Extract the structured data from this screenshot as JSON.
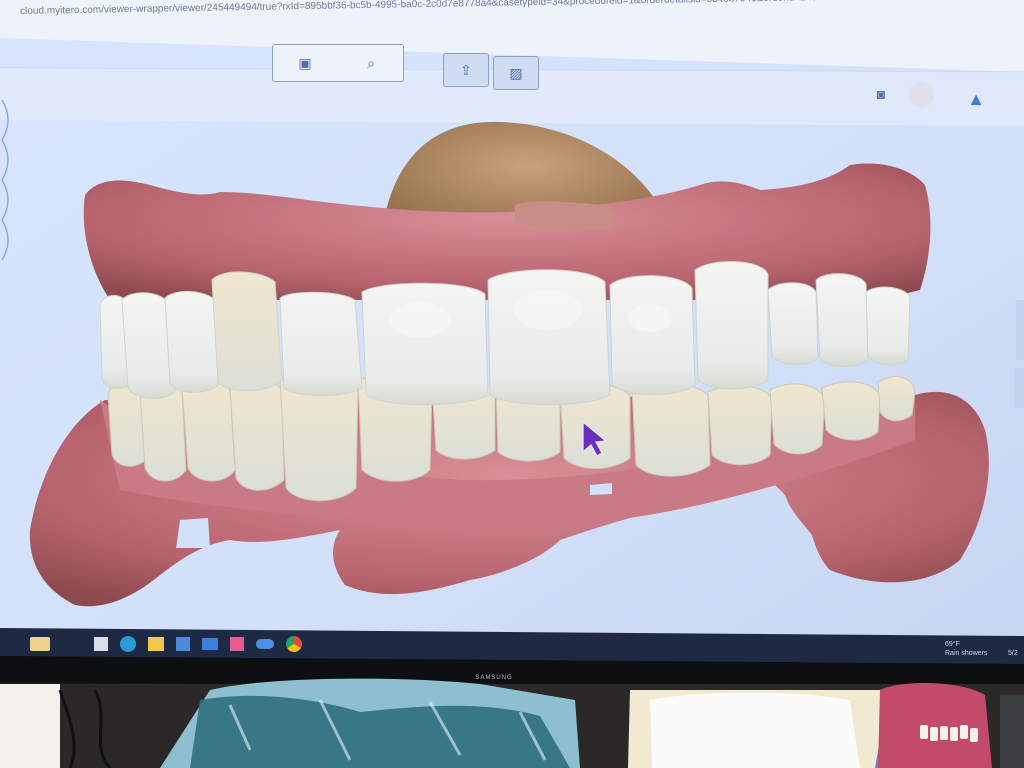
{
  "browser": {
    "url": "cloud.myitero.com/viewer-wrapper/viewer/245449494/true?rxId=895bbf36-bc5b-4995-ba0c-2c0d7e8778a4&casetypeid=34&procedureid=1&orderdetailsid=334087941&orderid=245449494&ordercode=0BJT1CM48&isOrtho=true&"
  },
  "toolbar": {
    "left_group": [
      "folder-icon",
      "search-icon"
    ],
    "right_group": [
      "share-icon",
      "image-icon"
    ],
    "corner_icons": [
      "camera-icon",
      "avatar-icon",
      "graduation-cap-icon"
    ]
  },
  "taskbar": {
    "icons": [
      "widgets-icon",
      "task-view-icon",
      "edge-icon",
      "file-explorer-icon",
      "store-icon",
      "mail-icon",
      "apps-icon",
      "onedrive-icon",
      "chrome-icon"
    ]
  },
  "tray": {
    "temperature": "69°F",
    "weather": "Rain showers",
    "time_fragment": "5/2"
  },
  "monitor": {
    "brand": "SAMSUNG"
  },
  "scene_objects": [
    "intraoral-3d-scan",
    "mouse-cursor",
    "plastic-wrapped-object",
    "tissue-box",
    "denture-model"
  ],
  "colors": {
    "screen_bg": "#d6e3fb",
    "gum": "#c97a84",
    "tooth": "#eef0ee",
    "cursor": "#6a2fc1"
  }
}
